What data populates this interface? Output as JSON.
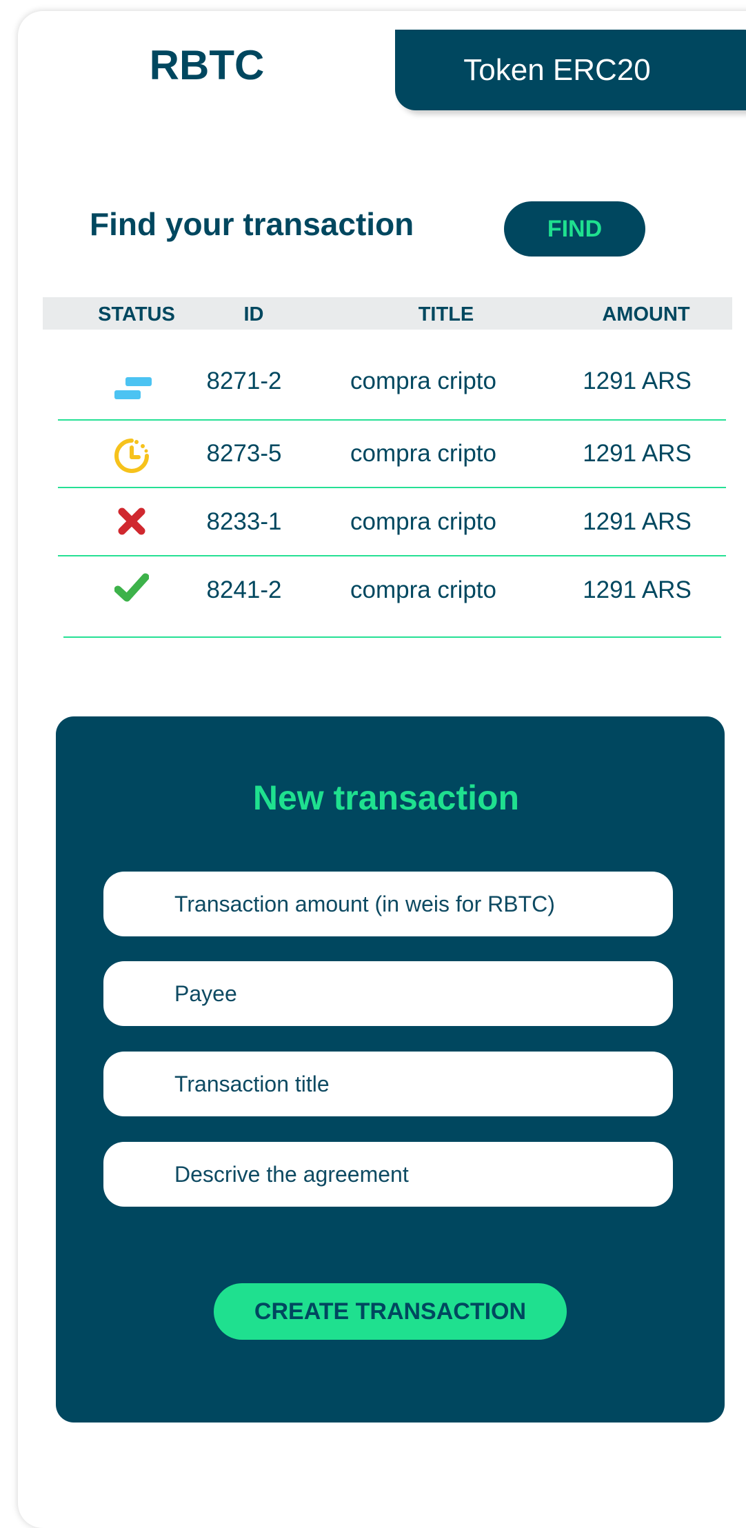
{
  "tabs": {
    "active": "RBTC",
    "inactive": "Token ERC20"
  },
  "search": {
    "title": "Find your transaction",
    "button": "FIND"
  },
  "table": {
    "columns": [
      "STATUS",
      "ID",
      "TITLE",
      "AMOUNT"
    ],
    "rows": [
      {
        "status": "in-progress",
        "status_icon": "progress-bars-icon",
        "id": "8271-2",
        "title": "compra cripto",
        "amount": "1291 ARS"
      },
      {
        "status": "pending",
        "status_icon": "clock-icon",
        "id": "8273-5",
        "title": "compra cripto",
        "amount": "1291 ARS"
      },
      {
        "status": "rejected",
        "status_icon": "x-mark-icon",
        "id": "8233-1",
        "title": "compra cripto",
        "amount": "1291 ARS"
      },
      {
        "status": "completed",
        "status_icon": "check-mark-icon",
        "id": "8241-2",
        "title": "compra cripto",
        "amount": "1291 ARS"
      }
    ]
  },
  "new_transaction": {
    "title": "New transaction",
    "amount_placeholder": "Transaction amount (in weis for RBTC)",
    "payee_placeholder": "Payee",
    "title_placeholder": "Transaction title",
    "agreement_placeholder": "Descrive the agreement",
    "submit": "CREATE TRANSACTION"
  },
  "colors": {
    "primary": "#00475f",
    "accent": "#1fe08f",
    "row_divider": "#25e094",
    "header_bg": "#e9ebec",
    "status_progress": "#4cc3f2",
    "status_pending": "#f6c21c",
    "status_rejected": "#d0282f",
    "status_completed": "#3db24a"
  }
}
